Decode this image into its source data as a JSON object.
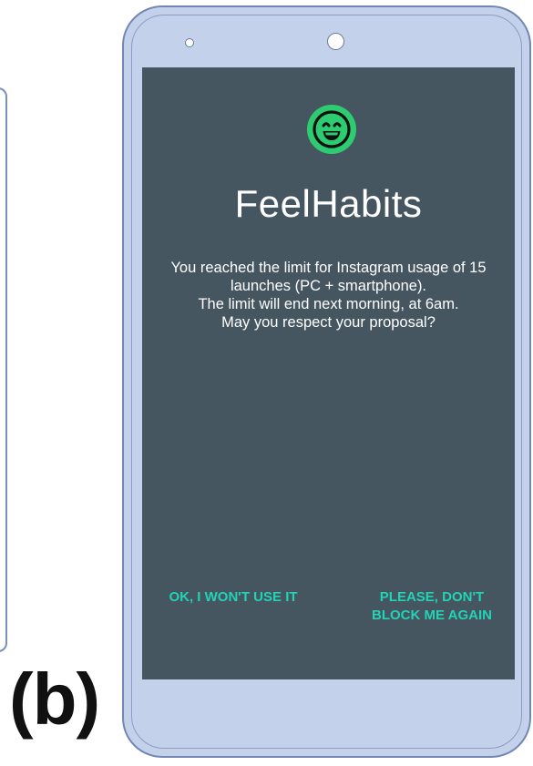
{
  "figure": {
    "label": "(b)"
  },
  "app": {
    "title": "FeelHabits",
    "logo_icon": "smiley-face-icon",
    "logo_color": "#2ecc71"
  },
  "dialog": {
    "message_lines": [
      "You reached the limit for Instagram usage of 15",
      "launches (PC + smartphone).",
      "The limit will end next morning, at 6am.",
      "May you respect your proposal?"
    ]
  },
  "actions": {
    "ok_label": "OK, I WON'T USE IT",
    "block_label_lines": [
      "PLEASE, DON'T",
      "BLOCK ME AGAIN"
    ],
    "accent_color": "#22d3b5"
  },
  "theme": {
    "screen_background": "#455661",
    "device_color": "#c3d1ea"
  }
}
